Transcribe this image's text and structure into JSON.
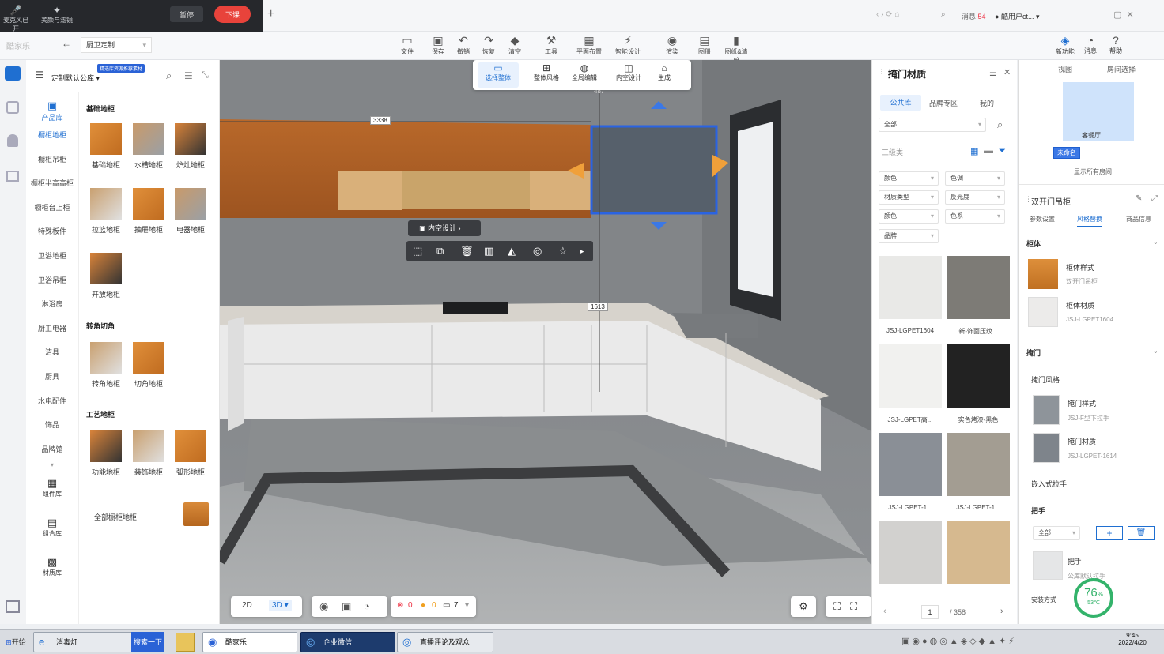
{
  "meeting": {
    "mic_label": "麦克风已开",
    "share_label": "美颜与滤镜",
    "pause_label": "暂停",
    "end_label": "下课"
  },
  "browser": {
    "new_tab": "+",
    "messages_label": "消息",
    "messages_count": "54",
    "user_label": "酷用户ct..."
  },
  "app": {
    "logo": "酷家乐",
    "room_select": "厨卫定制",
    "toolbar": [
      {
        "name": "file",
        "label": "文件",
        "glyph": "▭"
      },
      {
        "name": "save",
        "label": "保存",
        "glyph": "▣"
      },
      {
        "name": "undo",
        "label": "撤销",
        "glyph": "↶"
      },
      {
        "name": "redo",
        "label": "恢复",
        "glyph": "↷"
      },
      {
        "name": "clear",
        "label": "清空",
        "glyph": "◆"
      },
      {
        "name": "tools",
        "label": "工具",
        "glyph": "⚒"
      },
      {
        "name": "floor-layout",
        "label": "平面布置",
        "glyph": "▦"
      },
      {
        "name": "smart-design",
        "label": "智能设计",
        "glyph": "⚡"
      },
      {
        "name": "render",
        "label": "渲染",
        "glyph": "◉"
      },
      {
        "name": "drawings",
        "label": "图册",
        "glyph": "▤"
      },
      {
        "name": "drawings-list",
        "label": "图纸&清单",
        "glyph": "▮"
      }
    ],
    "right_toolbar": [
      {
        "name": "new-feature",
        "label": "新功能"
      },
      {
        "name": "message",
        "label": "消息"
      },
      {
        "name": "help",
        "label": "帮助"
      }
    ]
  },
  "rail": [
    "product-library-icon",
    "model-icon",
    "user-icon",
    "storage-icon",
    "layers-icon"
  ],
  "left_panel": {
    "library": "定制默认公库",
    "badge": "精选库资源推荐素材",
    "product_tab": "产品库",
    "categories": [
      "橱柜地柜",
      "橱柜吊柜",
      "橱柜半高高柜",
      "橱柜台上柜",
      "特殊板件",
      "卫浴地柜",
      "卫浴吊柜",
      "淋浴房",
      "厨卫电器",
      "洁具",
      "厨具",
      "水电配件",
      "饰品",
      "品牌馆"
    ],
    "bottom_tabs": [
      "组件库",
      "组合库",
      "材质库"
    ],
    "sections": [
      {
        "title": "基础地柜",
        "items": [
          "基础地柜",
          "水槽地柜",
          "炉灶地柜",
          "拉篮地柜",
          "抽屉地柜",
          "电器地柜",
          "开放地柜"
        ]
      },
      {
        "title": "转角切角",
        "items": [
          "转角地柜",
          "切角地柜"
        ]
      },
      {
        "title": "工艺地柜",
        "items": [
          "功能地柜",
          "装饰地柜",
          "弧形地柜"
        ]
      }
    ],
    "all_label": "全部橱柜地柜"
  },
  "canvas": {
    "top_tools": [
      "选择整体",
      "整体风格",
      "全局编辑",
      "内空设计",
      "生成"
    ],
    "dim_top": "3338",
    "dim_right": "1613",
    "dim_small": "487",
    "context_label": "内空设计",
    "bottom": {
      "view2d": "2D",
      "view3d": "3D",
      "errors": "0",
      "warnings": "0",
      "count": "7"
    }
  },
  "material_panel": {
    "title": "掩门材质",
    "tabs": [
      "公共库",
      "品牌专区",
      "我的"
    ],
    "category": "全部",
    "group_label": "三级类",
    "filters": [
      "颜色",
      "色调",
      "材质类型",
      "反光度",
      "颜色",
      "色系",
      "品牌"
    ],
    "swatches": [
      {
        "label": "JSJ-LGPET1604",
        "color": "#e9e9e7"
      },
      {
        "label": "新-饰面压纹...",
        "color": "#7d7b76"
      },
      {
        "label": "JSJ-LGPET高...",
        "color": "#f1f1ef"
      },
      {
        "label": "实色烤漆-黑色",
        "color": "#222222"
      },
      {
        "label": "JSJ-LGPET-1...",
        "color": "#8a8f96"
      },
      {
        "label": "JSJ-LGPET-1...",
        "color": "#a39d92"
      },
      {
        "label": "",
        "color": "#d2d1cf"
      },
      {
        "label": "",
        "color": "#d6b98f"
      }
    ],
    "page": "1",
    "total": "/ 358"
  },
  "minimap": {
    "tabs": [
      "视图",
      "房间选择"
    ],
    "room1": "客餐厅",
    "room2": "未命名",
    "show_all": "显示所有房间"
  },
  "prop_panel": {
    "title": "双开门吊柜",
    "tabs": [
      "参数设置",
      "风格替换",
      "商品信息"
    ],
    "cabinet_title": "柜体",
    "cabinet_style": "柜体样式",
    "cabinet_style_value": "双开门吊柜",
    "cabinet_material": "柜体材质",
    "cabinet_material_value": "JSJ-LGPET1604",
    "door_title": "掩门",
    "door_style_title": "掩门风格",
    "door_style": "掩门样式",
    "door_style_value": "JSJ-F型下拉手",
    "door_material": "掩门材质",
    "door_material_value": "JSJ-LGPET-1614",
    "embedded_handle": "嵌入式拉手",
    "handle_title": "把手",
    "handle_filter": "全部",
    "handle": "把手",
    "handle_value": "公库默认拉手",
    "install": "安装方式",
    "gauge_value": "76",
    "gauge_unit": "%",
    "gauge_temp": "53℃"
  },
  "taskbar": {
    "start": "开始",
    "ie": "消毒灯",
    "search": "搜索一下",
    "apps": [
      "酷家乐",
      "企业微信",
      "直播评论及观众"
    ],
    "time": "9:45",
    "date": "2022/4/20"
  }
}
